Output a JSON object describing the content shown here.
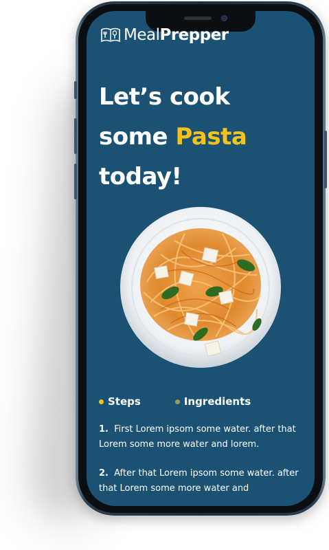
{
  "app": {
    "logo_light": "Meal",
    "logo_bold": "Prepper"
  },
  "hero": {
    "line1": "Let’s cook",
    "line2_prefix": "some ",
    "line2_accent": "Pasta",
    "line3": "today!"
  },
  "tabs": [
    {
      "label": "Steps",
      "dot_color": "#f3c31c",
      "active": true
    },
    {
      "label": "Ingredients",
      "dot_color": "#9a9a6a",
      "active": false
    }
  ],
  "steps": [
    {
      "num": "1.",
      "text": "First Lorem ipsom some water. after that Lorem some more water and lorem."
    },
    {
      "num": "2.",
      "text": "After that Lorem ipsom some water. after that Lorem some more water and"
    }
  ],
  "colors": {
    "screen_bg": "#1b5273",
    "accent": "#f3c31c",
    "text": "#ffffff"
  },
  "icons": [
    "logo-book-icon",
    "pasta-plate-image"
  ]
}
